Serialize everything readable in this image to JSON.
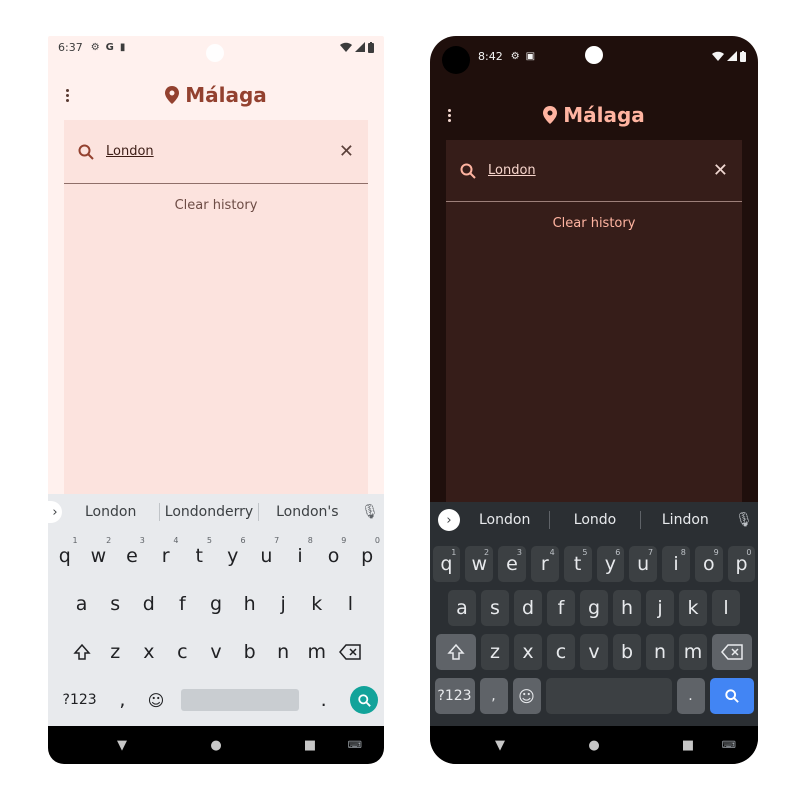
{
  "light": {
    "status": {
      "time": "6:37",
      "left_icons": [
        "gear-icon",
        "google-icon",
        "sim-icon"
      ],
      "right_icons": [
        "wifi-icon",
        "signal-icon",
        "battery-icon"
      ]
    },
    "app_title": "Málaga",
    "search": {
      "query": "London",
      "clear_history": "Clear history"
    },
    "suggestions": [
      "London",
      "Londonderry",
      "London's"
    ],
    "keys": {
      "row1": [
        [
          "q",
          "1"
        ],
        [
          "w",
          "2"
        ],
        [
          "e",
          "3"
        ],
        [
          "r",
          "4"
        ],
        [
          "t",
          "5"
        ],
        [
          "y",
          "6"
        ],
        [
          "u",
          "7"
        ],
        [
          "i",
          "8"
        ],
        [
          "o",
          "9"
        ],
        [
          "p",
          "0"
        ]
      ],
      "row2": [
        "a",
        "s",
        "d",
        "f",
        "g",
        "h",
        "j",
        "k",
        "l"
      ],
      "row3": [
        "z",
        "x",
        "c",
        "v",
        "b",
        "n",
        "m"
      ],
      "sym": "?123",
      "comma": ",",
      "period": "."
    },
    "colors": {
      "accent": "#93412f",
      "background": "#fff1ee",
      "search_key": "#12a39a"
    }
  },
  "dark": {
    "status": {
      "time": "8:42",
      "left_icons": [
        "gear-icon",
        "sim-icon"
      ],
      "right_icons": [
        "wifi-icon",
        "signal-icon",
        "battery-icon"
      ]
    },
    "app_title": "Málaga",
    "search": {
      "query": "London",
      "clear_history": "Clear history"
    },
    "suggestions": [
      "London",
      "Londo",
      "Lindon"
    ],
    "keys": {
      "row1": [
        [
          "q",
          "1"
        ],
        [
          "w",
          "2"
        ],
        [
          "e",
          "3"
        ],
        [
          "r",
          "4"
        ],
        [
          "t",
          "5"
        ],
        [
          "y",
          "6"
        ],
        [
          "u",
          "7"
        ],
        [
          "i",
          "8"
        ],
        [
          "o",
          "9"
        ],
        [
          "p",
          "0"
        ]
      ],
      "row2": [
        "a",
        "s",
        "d",
        "f",
        "g",
        "h",
        "j",
        "k",
        "l"
      ],
      "row3": [
        "z",
        "x",
        "c",
        "v",
        "b",
        "n",
        "m"
      ],
      "sym": "?123",
      "comma": ",",
      "period": "."
    },
    "colors": {
      "accent": "#ffb4a1",
      "background": "#1f0f0c",
      "search_key": "#4285f4"
    }
  }
}
